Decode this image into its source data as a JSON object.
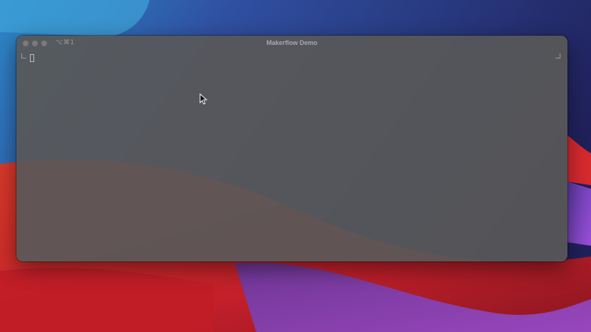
{
  "window": {
    "title": "Makerflow Demo",
    "shortcut": "⌥⌘1"
  },
  "icons": {
    "close": "close-button-icon",
    "minimize": "minimize-button-icon",
    "zoom": "zoom-button-icon",
    "pointer": "mouse-pointer-icon"
  },
  "colors": {
    "window_bg": "#585858",
    "title_text": "#a9a9a9"
  }
}
